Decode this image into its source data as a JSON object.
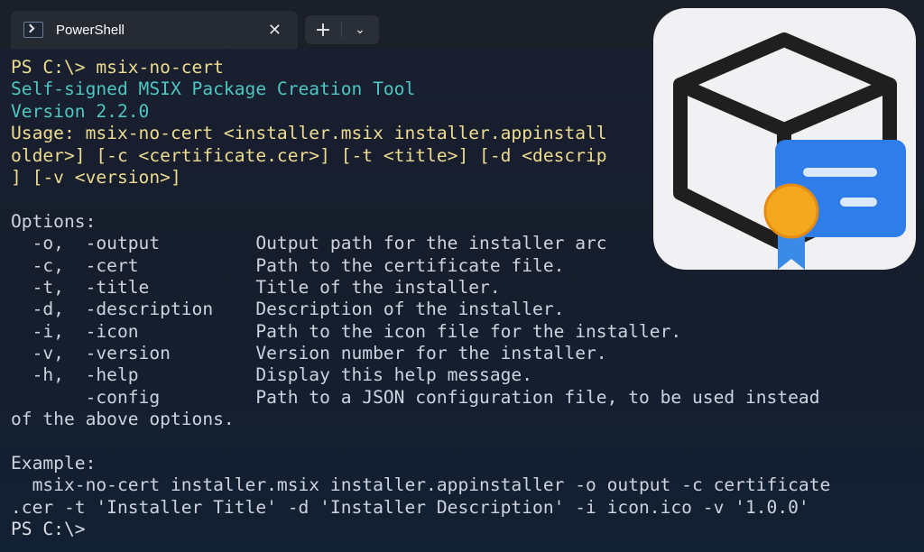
{
  "window": {
    "tab_title": "PowerShell",
    "tab_icon": "powershell-icon",
    "close_icon": "close-icon",
    "new_tab_icon": "plus-icon",
    "dropdown_icon": "chevron-down-icon"
  },
  "terminal": {
    "lines": [
      {
        "text": "PS C:\\> msix-no-cert",
        "color": "#eddc8f"
      },
      {
        "text": "Self-signed MSIX Package Creation Tool",
        "color": "#4ec6c2"
      },
      {
        "text": "Version 2.2.0",
        "color": "#4ec6c2"
      },
      {
        "text": "Usage: msix-no-cert <installer.msix installer.appinstall",
        "color": "#eddc8f"
      },
      {
        "text": "older>] [-c <certificate.cer>] [-t <title>] [-d <descrip",
        "color": "#eddc8f"
      },
      {
        "text": "] [-v <version>]",
        "color": "#eddc8f"
      },
      {
        "text": "",
        "color": "#cdd3de"
      },
      {
        "text": "Options:",
        "color": "#cdd3de"
      },
      {
        "text": "  -o,  -output         Output path for the installer arc",
        "color": "#cdd3de"
      },
      {
        "text": "  -c,  -cert           Path to the certificate file.",
        "color": "#cdd3de"
      },
      {
        "text": "  -t,  -title          Title of the installer.",
        "color": "#cdd3de"
      },
      {
        "text": "  -d,  -description    Description of the installer.",
        "color": "#cdd3de"
      },
      {
        "text": "  -i,  -icon           Path to the icon file for the installer.",
        "color": "#cdd3de"
      },
      {
        "text": "  -v,  -version        Version number for the installer.",
        "color": "#cdd3de"
      },
      {
        "text": "  -h,  -help           Display this help message.",
        "color": "#cdd3de"
      },
      {
        "text": "       -config         Path to a JSON configuration file, to be used instead",
        "color": "#cdd3de"
      },
      {
        "text": "of the above options.",
        "color": "#cdd3de"
      },
      {
        "text": "",
        "color": "#cdd3de"
      },
      {
        "text": "Example:",
        "color": "#cdd3de"
      },
      {
        "text": "  msix-no-cert installer.msix installer.appinstaller -o output -c certificate",
        "color": "#cdd3de"
      },
      {
        "text": ".cer -t 'Installer Title' -d 'Installer Description' -i icon.ico -v '1.0.0'",
        "color": "#cdd3de"
      },
      {
        "text": "PS C:\\>",
        "color": "#d9dde5"
      }
    ]
  },
  "overlay": {
    "icon": "package-certificate-icon",
    "colors": {
      "tile": "#f1f1f3",
      "box_stroke": "#1f1f1f",
      "card": "#2f7de8",
      "medal": "#f4a81d",
      "ribbon": "#3a8ae8"
    }
  }
}
